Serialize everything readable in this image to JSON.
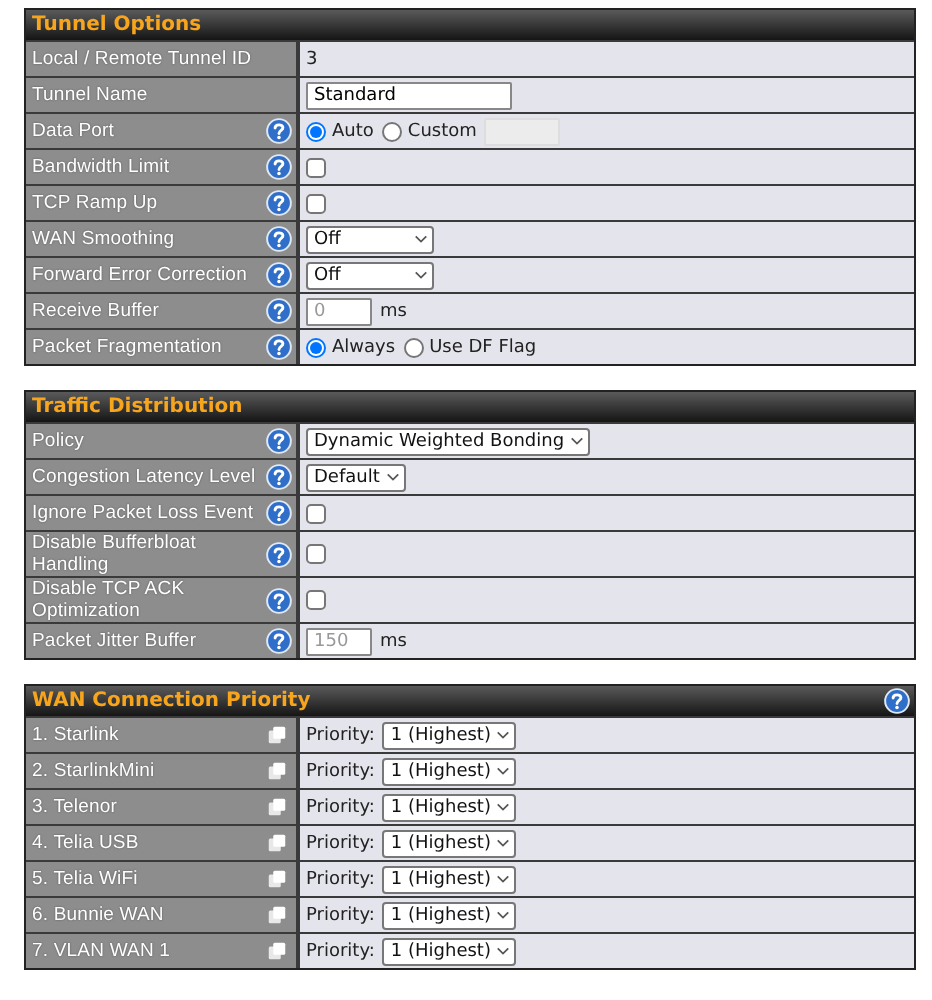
{
  "sections": [
    {
      "title": "Tunnel Options",
      "help": false,
      "rows": [
        {
          "label": "Local / Remote Tunnel ID",
          "help": false,
          "kind": "text",
          "value": "3"
        },
        {
          "label": "Tunnel Name",
          "help": false,
          "kind": "input",
          "value": "Standard"
        },
        {
          "label": "Data Port",
          "help": true,
          "kind": "radio",
          "options": [
            {
              "label": "Auto",
              "selected": true
            },
            {
              "label": "Custom",
              "selected": false
            }
          ],
          "custom_field": {
            "disabled": true
          }
        },
        {
          "label": "Bandwidth Limit",
          "help": true,
          "kind": "checkbox",
          "checked": false
        },
        {
          "label": "TCP Ramp Up",
          "help": true,
          "kind": "checkbox",
          "checked": false
        },
        {
          "label": "WAN Smoothing",
          "help": true,
          "kind": "wide_select",
          "value": "Off"
        },
        {
          "label": "Forward Error Correction",
          "help": true,
          "kind": "wide_select",
          "value": "Off"
        },
        {
          "label": "Receive Buffer",
          "help": true,
          "kind": "number",
          "placeholder": "0",
          "unit": "ms"
        },
        {
          "label": "Packet Fragmentation",
          "help": true,
          "kind": "radio",
          "options": [
            {
              "label": "Always",
              "selected": true
            },
            {
              "label": "Use DF Flag",
              "selected": false
            }
          ]
        }
      ]
    },
    {
      "title": "Traffic Distribution",
      "help": false,
      "rows": [
        {
          "label": "Policy",
          "help": true,
          "kind": "select",
          "value": "Dynamic Weighted Bonding"
        },
        {
          "label": "Congestion Latency Level",
          "help": true,
          "kind": "select",
          "value": "Default"
        },
        {
          "label": "Ignore Packet Loss Event",
          "help": true,
          "kind": "checkbox",
          "checked": false
        },
        {
          "label": "Disable Bufferbloat Handling",
          "help": true,
          "kind": "checkbox",
          "checked": false
        },
        {
          "label": "Disable TCP ACK Optimization",
          "help": true,
          "kind": "checkbox",
          "checked": false
        },
        {
          "label": "Packet Jitter Buffer",
          "help": true,
          "kind": "number",
          "placeholder": "150",
          "unit": "ms"
        }
      ]
    },
    {
      "title": "WAN Connection Priority",
      "help": true,
      "rows": [
        {
          "label": "1. Starlink",
          "kind": "priority",
          "prefix": "Priority:",
          "value": "1 (Highest)"
        },
        {
          "label": "2. StarlinkMini",
          "kind": "priority",
          "prefix": "Priority:",
          "value": "1 (Highest)"
        },
        {
          "label": "3. Telenor",
          "kind": "priority",
          "prefix": "Priority:",
          "value": "1 (Highest)"
        },
        {
          "label": "4. Telia USB",
          "kind": "priority",
          "prefix": "Priority:",
          "value": "1 (Highest)"
        },
        {
          "label": "5. Telia WiFi",
          "kind": "priority",
          "prefix": "Priority:",
          "value": "1 (Highest)"
        },
        {
          "label": "6. Bunnie WAN",
          "kind": "priority",
          "prefix": "Priority:",
          "value": "1 (Highest)"
        },
        {
          "label": "7. VLAN WAN 1",
          "kind": "priority",
          "prefix": "Priority:",
          "value": "1 (Highest)"
        }
      ]
    }
  ]
}
